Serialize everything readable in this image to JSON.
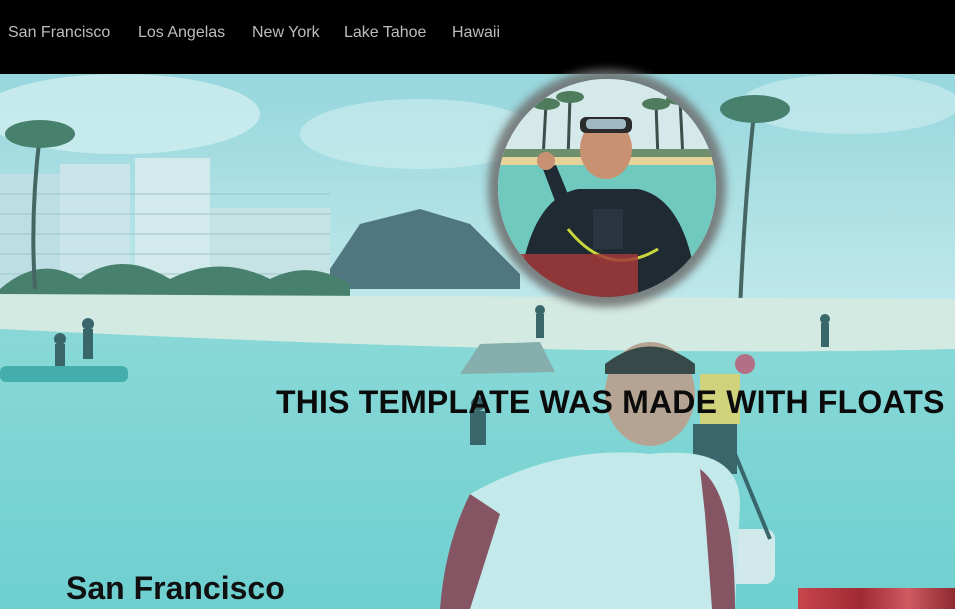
{
  "nav": {
    "items": [
      {
        "label": "San Francisco"
      },
      {
        "label": "Los Angelas"
      },
      {
        "label": "New York"
      },
      {
        "label": "Lake Tahoe"
      },
      {
        "label": "Hawaii"
      }
    ]
  },
  "hero": {
    "headline": "THIS TEMPLATE WAS MADE WITH FLOATS"
  },
  "section": {
    "title": "San Francisco"
  },
  "colors": {
    "nav_bg": "#000000",
    "nav_text": "#bdbdbd",
    "water": "#7fd3d6",
    "sky": "#bfe6ea"
  }
}
